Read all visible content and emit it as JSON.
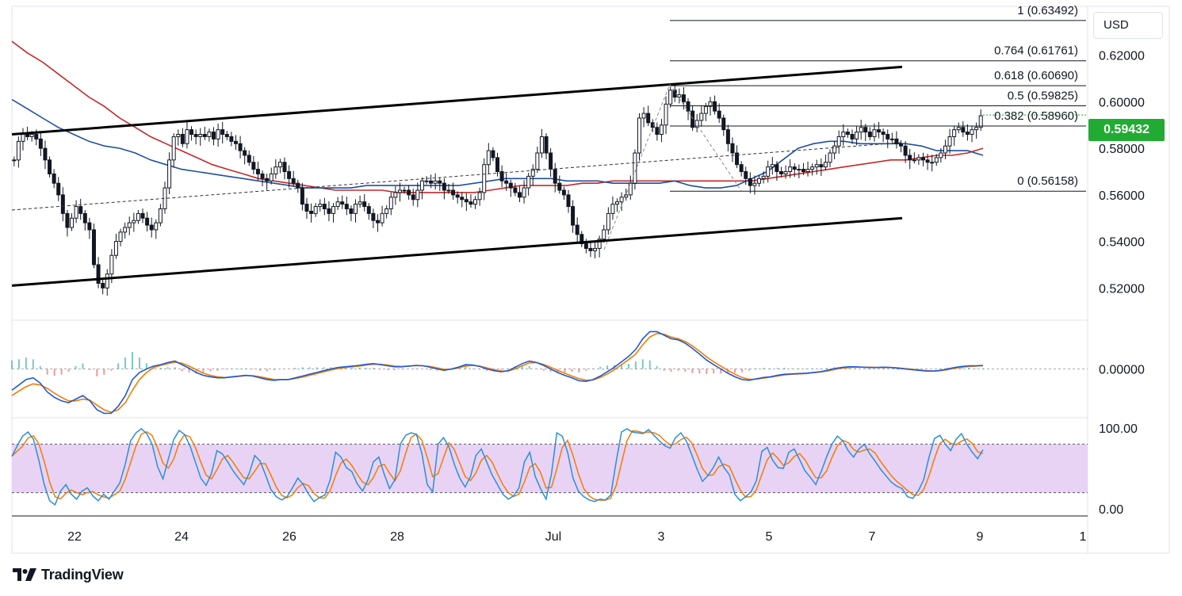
{
  "chart_data": [
    {
      "type": "candlestick",
      "title": "",
      "currency": "USD",
      "last_price": "0.59432",
      "price_ticks": [
        "0.62000",
        "0.60000",
        "0.58000",
        "0.56000",
        "0.54000",
        "0.52000"
      ],
      "price_range": [
        0.5065,
        0.641
      ],
      "x_ticks": [
        "22",
        "24",
        "26",
        "28",
        "Jul",
        "3",
        "5",
        "7",
        "9",
        "1"
      ],
      "ohlc_closes": [
        0.575,
        0.583,
        0.586,
        0.585,
        0.586,
        0.584,
        0.58,
        0.575,
        0.569,
        0.565,
        0.56,
        0.552,
        0.546,
        0.55,
        0.555,
        0.552,
        0.548,
        0.545,
        0.53,
        0.522,
        0.52,
        0.526,
        0.534,
        0.54,
        0.544,
        0.546,
        0.548,
        0.549,
        0.552,
        0.55,
        0.547,
        0.545,
        0.548,
        0.554,
        0.563,
        0.575,
        0.585,
        0.586,
        0.582,
        0.588,
        0.586,
        0.585,
        0.586,
        0.585,
        0.587,
        0.584,
        0.588,
        0.586,
        0.585,
        0.583,
        0.582,
        0.579,
        0.577,
        0.574,
        0.571,
        0.569,
        0.567,
        0.566,
        0.569,
        0.572,
        0.574,
        0.57,
        0.567,
        0.565,
        0.563,
        0.556,
        0.553,
        0.552,
        0.555,
        0.556,
        0.554,
        0.552,
        0.555,
        0.557,
        0.556,
        0.554,
        0.552,
        0.556,
        0.557,
        0.555,
        0.552,
        0.549,
        0.548,
        0.552,
        0.554,
        0.559,
        0.561,
        0.562,
        0.562,
        0.56,
        0.558,
        0.562,
        0.566,
        0.566,
        0.565,
        0.566,
        0.565,
        0.562,
        0.562,
        0.56,
        0.559,
        0.558,
        0.557,
        0.556,
        0.558,
        0.561,
        0.573,
        0.579,
        0.576,
        0.57,
        0.566,
        0.565,
        0.563,
        0.561,
        0.559,
        0.563,
        0.568,
        0.571,
        0.578,
        0.585,
        0.578,
        0.571,
        0.565,
        0.562,
        0.56,
        0.555,
        0.547,
        0.543,
        0.539,
        0.537,
        0.536,
        0.537,
        0.541,
        0.545,
        0.552,
        0.556,
        0.557,
        0.559,
        0.56,
        0.565,
        0.578,
        0.593,
        0.595,
        0.591,
        0.589,
        0.586,
        0.59,
        0.599,
        0.605,
        0.602,
        0.603,
        0.6,
        0.596,
        0.589,
        0.592,
        0.595,
        0.598,
        0.6,
        0.596,
        0.593,
        0.588,
        0.582,
        0.578,
        0.573,
        0.57,
        0.567,
        0.564,
        0.565,
        0.567,
        0.568,
        0.572,
        0.573,
        0.57,
        0.569,
        0.57,
        0.572,
        0.571,
        0.571,
        0.57,
        0.571,
        0.572,
        0.573,
        0.572,
        0.574,
        0.578,
        0.581,
        0.585,
        0.587,
        0.586,
        0.584,
        0.587,
        0.589,
        0.587,
        0.585,
        0.588,
        0.587,
        0.586,
        0.584,
        0.584,
        0.582,
        0.581,
        0.577,
        0.575,
        0.575,
        0.576,
        0.575,
        0.574,
        0.574,
        0.576,
        0.578,
        0.581,
        0.585,
        0.588,
        0.589,
        0.587,
        0.586,
        0.588,
        0.589,
        0.594
      ],
      "sma_blue": [
        0.601,
        0.597,
        0.593,
        0.589,
        0.586,
        0.583,
        0.581,
        0.58,
        0.578,
        0.575,
        0.573,
        0.571,
        0.57,
        0.569,
        0.568,
        0.567,
        0.566,
        0.565,
        0.564,
        0.563,
        0.563,
        0.563,
        0.563,
        0.564,
        0.564,
        0.564,
        0.564,
        0.564,
        0.564,
        0.564,
        0.565,
        0.566,
        0.567,
        0.567,
        0.567,
        0.567,
        0.566,
        0.566,
        0.566,
        0.565,
        0.565,
        0.565,
        0.565,
        0.566,
        0.564,
        0.563,
        0.563,
        0.564,
        0.567,
        0.57,
        0.575,
        0.58,
        0.582,
        0.583,
        0.583,
        0.582,
        0.582,
        0.582,
        0.582,
        0.581,
        0.579,
        0.579,
        0.579,
        0.577
      ],
      "sma_red": [
        0.626,
        0.621,
        0.617,
        0.612,
        0.607,
        0.602,
        0.598,
        0.593,
        0.589,
        0.585,
        0.582,
        0.579,
        0.576,
        0.573,
        0.571,
        0.569,
        0.567,
        0.566,
        0.565,
        0.564,
        0.563,
        0.562,
        0.562,
        0.562,
        0.562,
        0.561,
        0.561,
        0.561,
        0.561,
        0.561,
        0.561,
        0.562,
        0.563,
        0.564,
        0.564,
        0.564,
        0.564,
        0.565,
        0.565,
        0.566,
        0.566,
        0.566,
        0.566,
        0.566,
        0.566,
        0.566,
        0.566,
        0.566,
        0.566,
        0.567,
        0.568,
        0.569,
        0.57,
        0.571,
        0.572,
        0.573,
        0.574,
        0.575,
        0.575,
        0.576,
        0.577,
        0.577,
        0.578,
        0.58
      ],
      "channel_upper": [
        [
          0,
          0.586
        ],
        [
          1,
          0.615
        ]
      ],
      "channel_lower": [
        [
          0,
          0.521
        ],
        [
          1,
          0.55
        ]
      ],
      "channel_mid": [
        [
          0,
          0.5535
        ],
        [
          1,
          0.5825
        ]
      ],
      "fibonacci": [
        {
          "label": "1 (0.63492)",
          "price": 0.63492
        },
        {
          "label": "0.764 (0.61761)",
          "price": 0.61761
        },
        {
          "label": "0.618 (0.60690)",
          "price": 0.6069
        },
        {
          "label": "0.5 (0.59825)",
          "price": 0.59825
        },
        {
          "label": "0.382 (0.58960)",
          "price": 0.5896
        },
        {
          "label": "0 (0.56158)",
          "price": 0.56158
        }
      ]
    },
    {
      "type": "line",
      "title": "",
      "zero_tick": "0.00000",
      "macd_line": [
        -0.006,
        -0.0045,
        -0.003,
        -0.0025,
        -0.004,
        -0.0065,
        -0.008,
        -0.009,
        -0.0095,
        -0.0085,
        -0.0075,
        -0.009,
        -0.0115,
        -0.0125,
        -0.0125,
        -0.0105,
        -0.0075,
        -0.003,
        -0.001,
        0.0,
        0.0008,
        0.0012,
        0.0018,
        0.0022,
        0.0012,
        0.0002,
        -0.001,
        -0.0018,
        -0.0022,
        -0.0025,
        -0.0025,
        -0.0022,
        -0.002,
        -0.0018,
        -0.002,
        -0.0025,
        -0.003,
        -0.0032,
        -0.003,
        -0.003,
        -0.0025,
        -0.002,
        -0.0015,
        -0.001,
        -0.0005,
        0.0,
        0.0004,
        0.0006,
        0.0008,
        0.001,
        0.0013,
        0.0015,
        0.0012,
        0.0009,
        0.0006,
        0.0006,
        0.0008,
        0.001,
        0.0009,
        0.0005,
        0.0,
        -0.0004,
        0.0,
        0.0005,
        0.0012,
        0.0011,
        0.0007,
        0.0,
        -0.0005,
        -0.0008,
        -0.0005,
        0.0005,
        0.0015,
        0.0022,
        0.0018,
        0.001,
        0.0,
        -0.001,
        -0.0018,
        -0.0025,
        -0.0033,
        -0.0035,
        -0.003,
        -0.002,
        -0.0008,
        0.0005,
        0.002,
        0.0035,
        0.0055,
        0.0085,
        0.0105,
        0.0105,
        0.0095,
        0.0085,
        0.0082,
        0.0072,
        0.0058,
        0.0042,
        0.0025,
        0.0012,
        0.0,
        -0.0012,
        -0.0022,
        -0.003,
        -0.0032,
        -0.0028,
        -0.0024,
        -0.0022,
        -0.0018,
        -0.0015,
        -0.0014,
        -0.0013,
        -0.0012,
        -0.001,
        -0.0008,
        -0.0004,
        0.0001,
        0.0004,
        0.0006,
        0.0006,
        0.0005,
        0.0004,
        0.0004,
        0.0005,
        0.0004,
        0.0002,
        0.0,
        -0.0002,
        -0.0004,
        -0.0006,
        -0.0006,
        -0.0004,
        0.0,
        0.0004,
        0.0007,
        0.0009,
        0.0009,
        0.001
      ],
      "signal_line": [
        -0.0075,
        -0.0062,
        -0.005,
        -0.0042,
        -0.0045,
        -0.0055,
        -0.0068,
        -0.008,
        -0.009,
        -0.009,
        -0.0085,
        -0.0088,
        -0.0102,
        -0.0115,
        -0.0122,
        -0.0115,
        -0.0095,
        -0.006,
        -0.003,
        -0.001,
        0.0004,
        0.001,
        0.0015,
        0.0019,
        0.0016,
        0.0008,
        -0.0002,
        -0.0012,
        -0.0018,
        -0.0022,
        -0.0024,
        -0.0023,
        -0.0021,
        -0.0019,
        -0.0019,
        -0.0022,
        -0.0026,
        -0.003,
        -0.003,
        -0.003,
        -0.0027,
        -0.0023,
        -0.0018,
        -0.0013,
        -0.0008,
        -0.0003,
        0.0001,
        0.0004,
        0.0006,
        0.0008,
        0.0011,
        0.0013,
        0.0013,
        0.0011,
        0.0008,
        0.0007,
        0.0008,
        0.0009,
        0.0009,
        0.0007,
        0.0003,
        -0.0001,
        -0.0001,
        0.0003,
        0.0008,
        0.001,
        0.0008,
        0.0003,
        -0.0002,
        -0.0006,
        -0.0006,
        0.0,
        0.0009,
        0.0017,
        0.0018,
        0.0013,
        0.0005,
        -0.0004,
        -0.0012,
        -0.002,
        -0.0027,
        -0.0032,
        -0.0031,
        -0.0024,
        -0.0014,
        -0.0002,
        0.0012,
        0.0026,
        0.0042,
        0.0068,
        0.009,
        0.01,
        0.0098,
        0.009,
        0.0085,
        0.0077,
        0.0065,
        0.005,
        0.0034,
        0.002,
        0.0008,
        -0.0004,
        -0.0015,
        -0.0024,
        -0.0029,
        -0.0029,
        -0.0026,
        -0.0023,
        -0.002,
        -0.0017,
        -0.0015,
        -0.0014,
        -0.0013,
        -0.0011,
        -0.0009,
        -0.0006,
        -0.0002,
        0.0002,
        0.0004,
        0.0005,
        0.0005,
        0.0005,
        0.0004,
        0.0004,
        0.0004,
        0.0003,
        0.0001,
        -0.0001,
        -0.0003,
        -0.0005,
        -0.0006,
        -0.0005,
        -0.0002,
        0.0002,
        0.0005,
        0.0007,
        0.0008,
        0.0009
      ]
    },
    {
      "type": "line",
      "title": "",
      "ticks": [
        "100.00",
        "0.00"
      ],
      "upper_band": 80,
      "lower_band": 20,
      "k_line": [
        65,
        78,
        90,
        95,
        86,
        60,
        30,
        10,
        5,
        22,
        30,
        18,
        12,
        22,
        26,
        16,
        10,
        18,
        12,
        22,
        32,
        55,
        84,
        94,
        99,
        93,
        80,
        52,
        37,
        62,
        86,
        97,
        92,
        78,
        58,
        38,
        29,
        44,
        72,
        68,
        58,
        47,
        38,
        30,
        44,
        66,
        59,
        42,
        24,
        15,
        11,
        15,
        26,
        38,
        30,
        18,
        9,
        14,
        17,
        36,
        70,
        64,
        51,
        46,
        31,
        22,
        36,
        58,
        64,
        43,
        25,
        36,
        80,
        91,
        94,
        92,
        68,
        30,
        21,
        80,
        88,
        77,
        55,
        38,
        27,
        40,
        66,
        74,
        58,
        42,
        30,
        18,
        12,
        16,
        26,
        58,
        70,
        40,
        25,
        12,
        43,
        94,
        90,
        70,
        38,
        22,
        15,
        11,
        9,
        12,
        11,
        17,
        58,
        95,
        99,
        95,
        94,
        93,
        98,
        91,
        84,
        78,
        75,
        88,
        94,
        84,
        67,
        49,
        34,
        41,
        51,
        64,
        51,
        42,
        18,
        10,
        15,
        21,
        35,
        71,
        76,
        60,
        51,
        50,
        70,
        74,
        61,
        47,
        39,
        30,
        46,
        64,
        80,
        90,
        84,
        72,
        64,
        74,
        80,
        68,
        59,
        49,
        41,
        33,
        28,
        25,
        15,
        13,
        22,
        36,
        64,
        87,
        91,
        80,
        72,
        86,
        93,
        80,
        70,
        62,
        73
      ]
    }
  ]
}
